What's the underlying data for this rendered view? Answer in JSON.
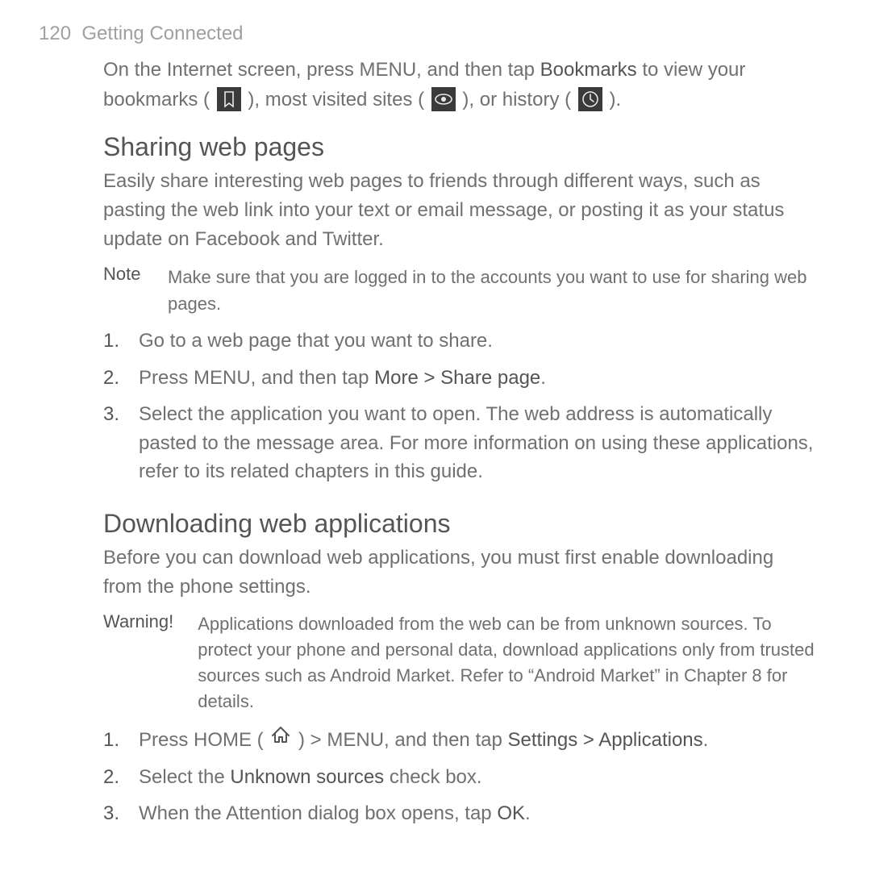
{
  "header": {
    "page_number": "120",
    "section_title": "Getting Connected"
  },
  "intro": {
    "line1_pre": "On the Internet screen, press MENU, and then tap ",
    "line1_bold": "Bookmarks",
    "line1_post": " to view your bookmarks ( ",
    "line2_mid1": " ), most visited sites ( ",
    "line2_mid2": " ), or history ( ",
    "line2_end": " )."
  },
  "sharing": {
    "heading": "Sharing web pages",
    "paragraph": "Easily share interesting web pages to friends through different ways, such as pasting the web link into your text or email message, or posting it as your status update on Facebook and Twitter.",
    "note_label": "Note",
    "note_text": "Make sure that you are logged in to the accounts you want to use for sharing web pages.",
    "steps": [
      {
        "text": "Go to a web page that you want to share."
      },
      {
        "pre": "Press MENU, and then tap ",
        "bold": "More > Share page",
        "post": "."
      },
      {
        "text": "Select the application you want to open. The web address is automatically pasted to the message area. For more information on using these applications, refer to its related chapters in this guide."
      }
    ]
  },
  "downloading": {
    "heading": "Downloading web applications",
    "paragraph": "Before you can download web applications, you must first enable downloading from the phone settings.",
    "warning_label": "Warning!",
    "warning_text": "Applications downloaded from the web can be from unknown sources. To protect your phone and personal data, download applications only from trusted sources such as Android Market. Refer to “Android Market” in Chapter 8 for details.",
    "steps": [
      {
        "pre": "Press HOME ( ",
        "mid": " ) > MENU, and then tap ",
        "bold": "Settings > Applications",
        "post": "."
      },
      {
        "pre": "Select the ",
        "bold": "Unknown sources",
        "post": " check box."
      },
      {
        "pre": "When the Attention dialog box opens, tap ",
        "bold": "OK",
        "post": "."
      }
    ]
  }
}
